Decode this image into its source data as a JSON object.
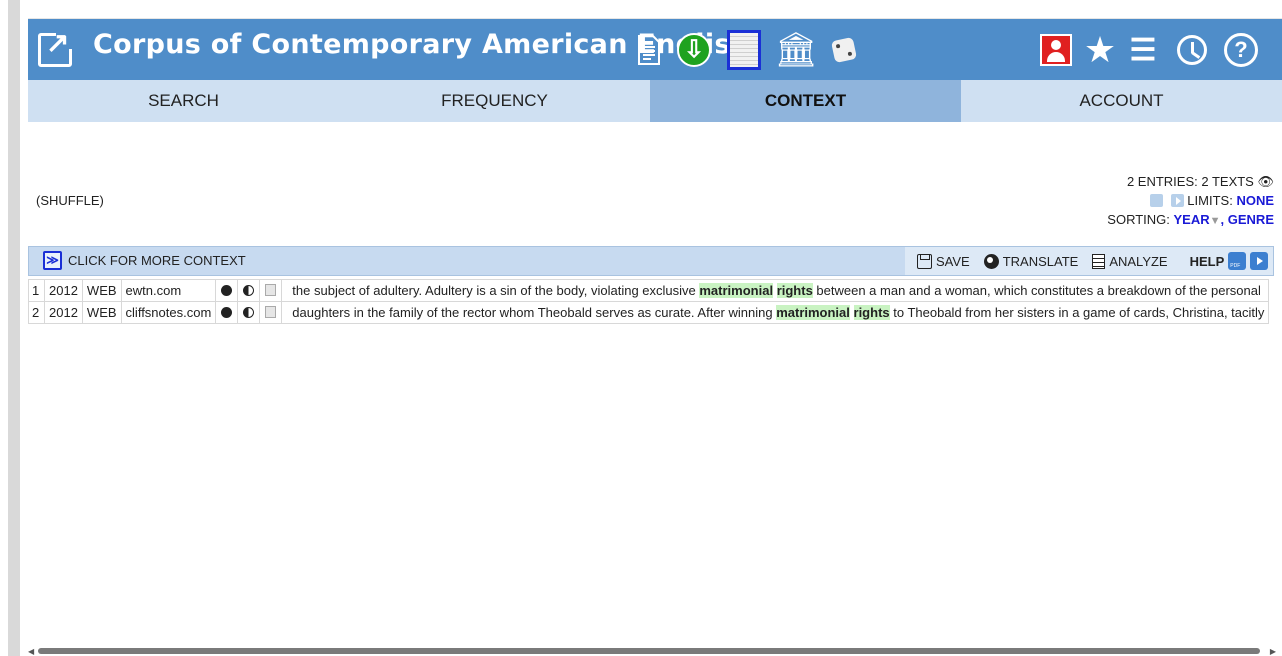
{
  "header": {
    "title": "Corpus of Contemporary American English",
    "museum_glyph": "🏛",
    "star_glyph": "★",
    "list_glyph": "☰",
    "help_glyph": "?",
    "download_glyph": "⇩",
    "icons": [
      "external-link-icon",
      "document-icon",
      "download-icon",
      "book-icon",
      "museum-icon",
      "dice-icon",
      "user-icon",
      "star-icon",
      "list-icon",
      "history-icon",
      "help-icon"
    ]
  },
  "nav": {
    "tabs": [
      {
        "label": "SEARCH"
      },
      {
        "label": "FREQUENCY"
      },
      {
        "label": "CONTEXT",
        "active": true
      },
      {
        "label": "ACCOUNT"
      }
    ]
  },
  "info": {
    "shuffle": "(SHUFFLE)",
    "entries": "2 ENTRIES: 2 TEXTS",
    "eye_glyph": "👁",
    "limits_label": "LIMITS:",
    "limits_value": "NONE",
    "sorting_label": "SORTING:",
    "sort_year": "YEAR",
    "sort_arrow": "▼",
    "sort_genre": ", GENRE"
  },
  "toolbar": {
    "more_context": "CLICK FOR MORE CONTEXT",
    "expand_glyph": "≫",
    "save": "SAVE",
    "translate": "TRANSLATE",
    "analyze": "ANALYZE",
    "help": "HELP"
  },
  "rows": [
    {
      "num": "1",
      "year": "2012",
      "genre": "WEB",
      "source": "ewtn.com",
      "pre": "the subject of adultery. Adultery is a sin of the body, violating exclusive ",
      "kw1": "matrimonial",
      "kw2": "rights",
      "post": " between a man and a woman, which constitutes a breakdown of the personal"
    },
    {
      "num": "2",
      "year": "2012",
      "genre": "WEB",
      "source": "cliffsnotes.com",
      "pre": "daughters in the family of the rector whom Theobald serves as curate. After winning ",
      "kw1": "matrimonial",
      "kw2": "rights",
      "post": " to Theobald from her sisters in a game of cards, Christina, tacitly"
    }
  ],
  "colors": {
    "header_bg": "#4f8dc9",
    "nav_bg": "#cfe0f2",
    "nav_active": "#8fb4dc",
    "highlight": "#c9f3c2",
    "link_blue": "#1a1ad6"
  }
}
